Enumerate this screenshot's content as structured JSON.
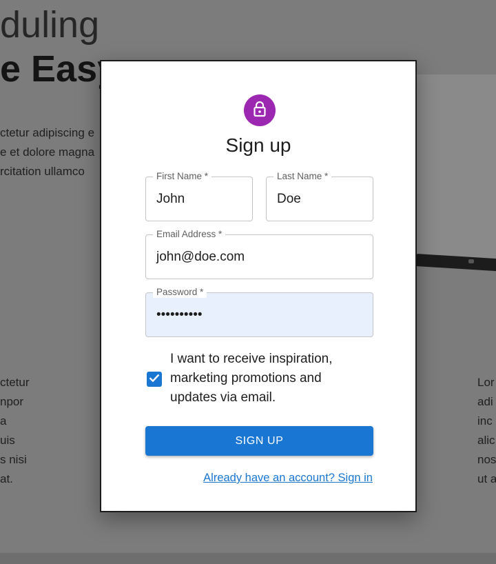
{
  "background": {
    "heading_line1": "duling",
    "heading_line2": "e Easy",
    "left_paragraph_top": [
      "ctetur adipiscing e",
      "e et dolore magna",
      "rcitation ullamco"
    ],
    "left_paragraph_bottom": [
      "ctetur",
      "npor",
      "a",
      "uis",
      "s nisi",
      "at."
    ],
    "right_paragraph_bottom": [
      "Lor",
      "adi",
      "inc",
      "alic",
      "nos",
      "ut a"
    ]
  },
  "dialog": {
    "icon": "lock-icon",
    "title": "Sign up",
    "first_name": {
      "label": "First Name *",
      "value": "John"
    },
    "last_name": {
      "label": "Last Name *",
      "value": "Doe"
    },
    "email": {
      "label": "Email Address *",
      "value": "john@doe.com"
    },
    "password": {
      "label": "Password *",
      "value": "••••••••••"
    },
    "marketing_opt_in": {
      "checked": true,
      "label": "I want to receive inspiration, marketing promotions and updates via email."
    },
    "signup_button": "SIGN UP",
    "signin_link": "Already have an account? Sign in"
  },
  "colors": {
    "primary": "#1976d2",
    "avatar": "#9c27b0",
    "autofill": "#e8f0fe"
  }
}
